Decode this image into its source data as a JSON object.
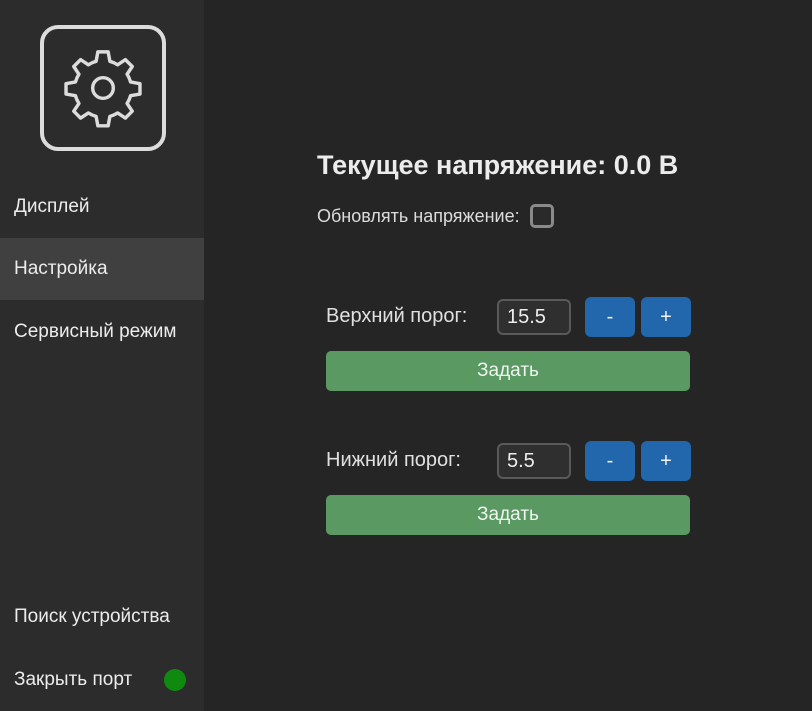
{
  "sidebar": {
    "logo_icon": "gear-icon",
    "items": [
      {
        "label": "Дисплей"
      },
      {
        "label": "Настройка"
      },
      {
        "label": "Сервисный режим"
      }
    ],
    "bottom": {
      "search_label": "Поиск устройства",
      "close_port_label": "Закрыть порт",
      "port_status_color": "#0f8a0f"
    }
  },
  "main": {
    "voltage_title": "Текущее напряжение: 0.0 В",
    "update_label": "Обновлять напряжение:",
    "update_checked": false,
    "upper": {
      "label": "Верхний порог:",
      "value": "15.5",
      "minus_label": "-",
      "plus_label": "+",
      "set_label": "Задать"
    },
    "lower": {
      "label": "Нижний порог:",
      "value": "5.5",
      "minus_label": "-",
      "plus_label": "+",
      "set_label": "Задать"
    }
  },
  "colors": {
    "accent_blue": "#2267ab",
    "accent_green": "#5a9a62",
    "background": "#252525",
    "sidebar_bg": "#2c2c2c",
    "active_item_bg": "#404040"
  }
}
